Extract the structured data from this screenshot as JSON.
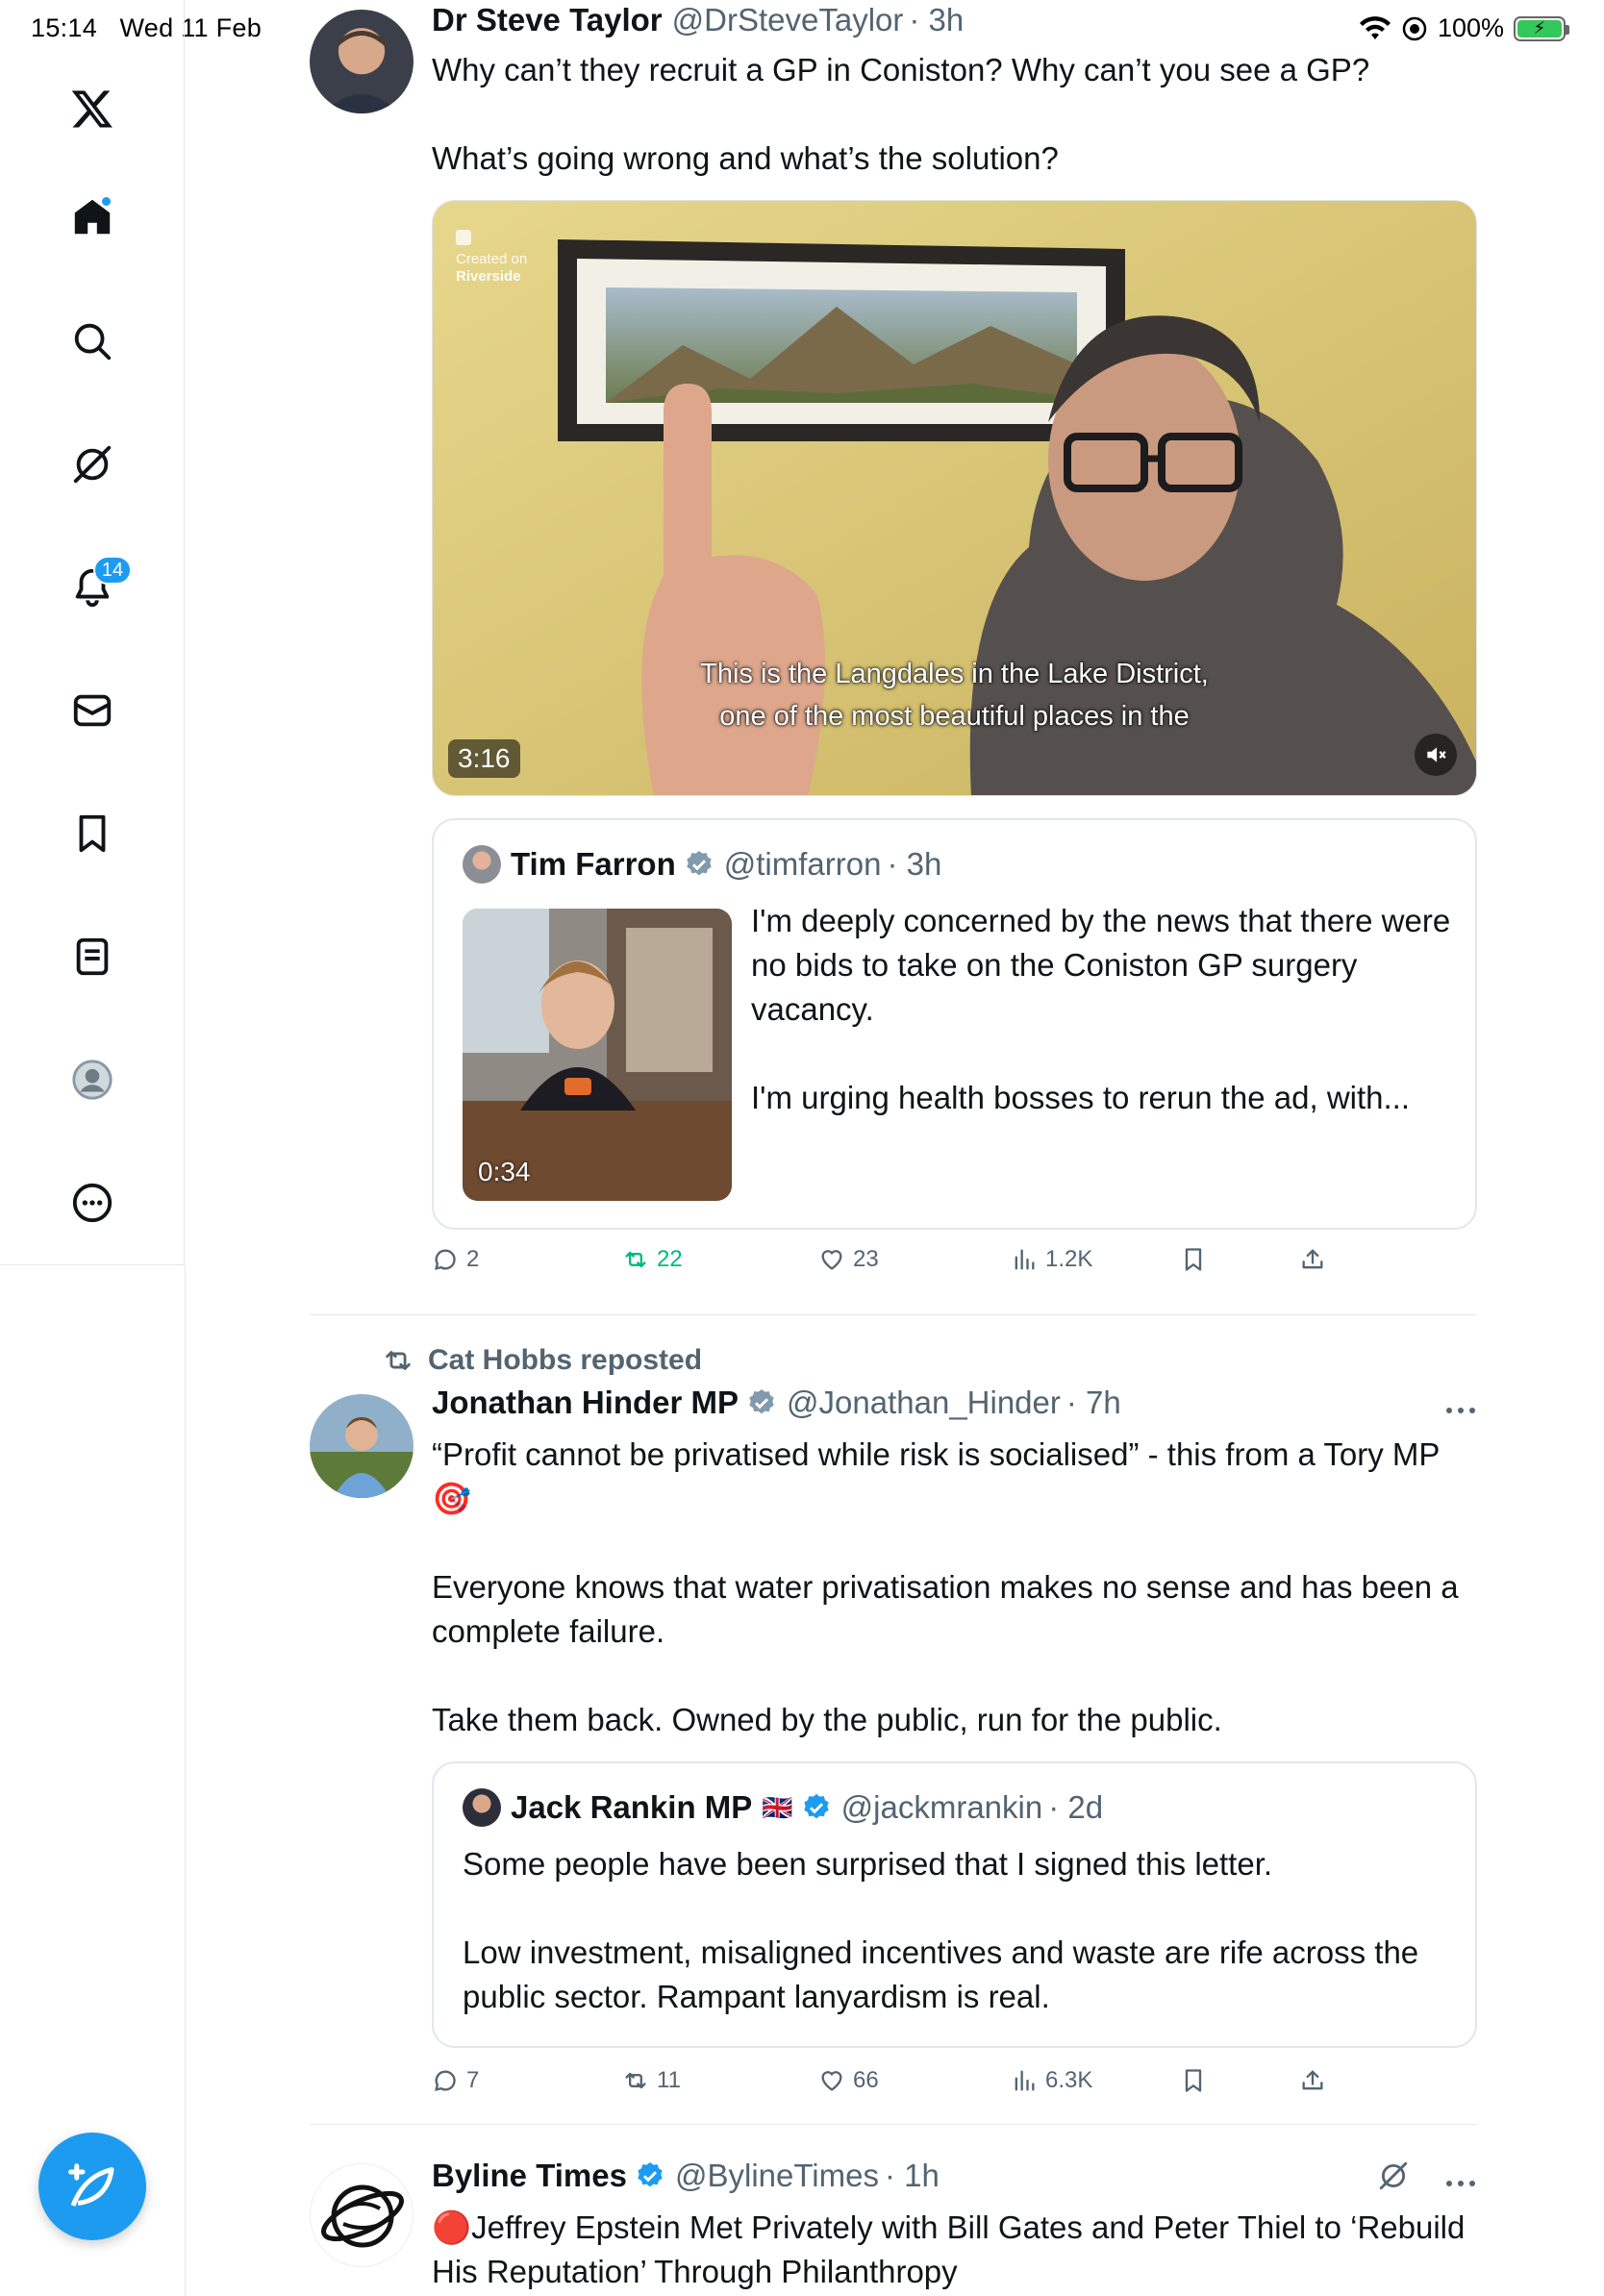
{
  "status_bar": {
    "time": "15:14",
    "date": "Wed 11 Feb",
    "battery": "100%"
  },
  "sidebar": {
    "notifications_badge": "14",
    "items": [
      "x-logo",
      "home-icon",
      "search-icon",
      "grok-icon",
      "bell-icon",
      "mail-icon",
      "bookmark-icon",
      "lists-icon",
      "profile-icon",
      "more-icon"
    ]
  },
  "tweet1": {
    "name": "Dr Steve Taylor",
    "handle": "@DrSteveTaylor",
    "time": "· 3h",
    "text": "Why can’t they recruit a GP in Coniston? Why can’t you see a GP?\n\nWhat’s going wrong and what’s the solution?",
    "video": {
      "created_on_label": "Created on",
      "created_on_app": "Riverside",
      "caption_line1": "This is the Langdales in the Lake District,",
      "caption_line2": "one of the most beautiful places in the",
      "duration": "3:16"
    },
    "quote": {
      "name": "Tim Farron",
      "handle": "@timfarron",
      "time": "· 3h",
      "text": "I'm deeply concerned by the news that there were no bids to take on the Coniston GP surgery vacancy.\n\nI'm urging health bosses to rerun the ad, with...",
      "video_duration": "0:34"
    },
    "actions": {
      "replies": "2",
      "reposts": "22",
      "likes": "23",
      "views": "1.2K"
    }
  },
  "tweet2": {
    "repost_label": "Cat Hobbs reposted",
    "name": "Jonathan Hinder MP",
    "handle": "@Jonathan_Hinder",
    "time": "· 7h",
    "text": "“Profit cannot be privatised while risk is socialised” - this from a Tory MP 🎯\n\nEveryone knows that water privatisation makes no sense and has been a complete failure.\n\nTake them back. Owned by the public, run for the public.",
    "quote": {
      "name": "Jack Rankin MP",
      "flag": "🇬🇧",
      "handle": "@jackmrankin",
      "time": "· 2d",
      "text": "Some people have been surprised that I signed this letter.\n\nLow investment, misaligned incentives and waste are rife across the public sector. Rampant lanyardism is real."
    },
    "actions": {
      "replies": "7",
      "reposts": "11",
      "likes": "66",
      "views": "6.3K"
    }
  },
  "tweet3": {
    "name": "Byline Times",
    "handle": "@BylineTimes",
    "time": "· 1h",
    "text": "🔴Jeffrey Epstein Met Privately with Bill Gates and Peter Thiel to ‘Rebuild His Reputation’ Through Philanthropy"
  },
  "colors": {
    "accent": "#1d9bf0",
    "repost_green": "#00ba7c",
    "muted": "#536471"
  }
}
